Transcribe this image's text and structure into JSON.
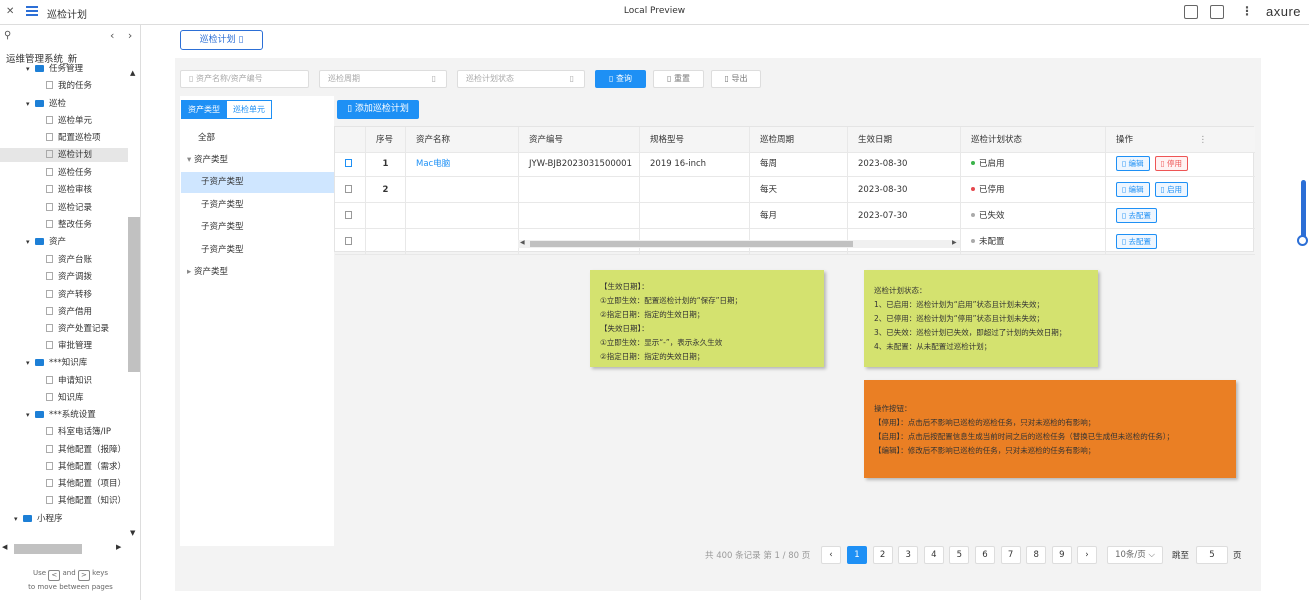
{
  "viewer": {
    "page_name": "巡检计划",
    "title": "Local Preview",
    "logo": "axure",
    "help_text_1": "Use",
    "help_text_2": "and",
    "help_text_3": "keys",
    "help_text_4": "to move between pages",
    "key_left": "<",
    "key_right": ">"
  },
  "sidebar": {
    "project": "运维管理系统_新",
    "items": [
      {
        "label": "任务管理",
        "type": "folder"
      },
      {
        "label": "我的任务",
        "type": "page"
      },
      {
        "label": "巡检",
        "type": "folder"
      },
      {
        "label": "巡检单元",
        "type": "page"
      },
      {
        "label": "配置巡检项",
        "type": "page"
      },
      {
        "label": "巡检计划",
        "type": "page",
        "selected": true
      },
      {
        "label": "巡检任务",
        "type": "page"
      },
      {
        "label": "巡检审核",
        "type": "page"
      },
      {
        "label": "巡检记录",
        "type": "page"
      },
      {
        "label": "整改任务",
        "type": "page"
      },
      {
        "label": "资产",
        "type": "folder"
      },
      {
        "label": "资产台账",
        "type": "page"
      },
      {
        "label": "资产调拨",
        "type": "page"
      },
      {
        "label": "资产转移",
        "type": "page"
      },
      {
        "label": "资产借用",
        "type": "page"
      },
      {
        "label": "资产处置记录",
        "type": "page"
      },
      {
        "label": "审批管理",
        "type": "page"
      },
      {
        "label": "***知识库",
        "type": "folder"
      },
      {
        "label": "申请知识",
        "type": "page"
      },
      {
        "label": "知识库",
        "type": "page"
      },
      {
        "label": "***系统设置",
        "type": "folder"
      },
      {
        "label": "科室电话簿/IP",
        "type": "page"
      },
      {
        "label": "其他配置（报障）",
        "type": "page"
      },
      {
        "label": "其他配置（需求）",
        "type": "page"
      },
      {
        "label": "其他配置（项目）",
        "type": "page"
      },
      {
        "label": "其他配置（知识）",
        "type": "page"
      },
      {
        "label": "小程序",
        "type": "folder"
      }
    ]
  },
  "page": {
    "tab_label": "巡检计划",
    "filters": {
      "asset": "资产名称/资产编号",
      "cycle": "巡检周期",
      "status": "巡检计划状态"
    },
    "buttons": {
      "query": "查询",
      "reset": "重置",
      "export": "导出",
      "add": "添加巡检计划"
    },
    "segment": {
      "asset_type": "资产类型",
      "unit": "巡检单元"
    },
    "categories": [
      {
        "label": "全部",
        "level": 0
      },
      {
        "label": "资产类型",
        "level": 1,
        "expanded": true
      },
      {
        "label": "子资产类型",
        "level": 2,
        "selected": true
      },
      {
        "label": "子资产类型",
        "level": 2
      },
      {
        "label": "子资产类型",
        "level": 2
      },
      {
        "label": "子资产类型",
        "level": 2
      },
      {
        "label": "资产类型",
        "level": 1,
        "expanded": false
      }
    ],
    "table": {
      "columns": [
        "序号",
        "资产名称",
        "资产编号",
        "规格型号",
        "巡检周期",
        "生效日期",
        "巡检计划状态",
        "操作"
      ],
      "rows": [
        {
          "no": "1",
          "name": "Mac电脑",
          "code": "JYW-BJB2023031500001",
          "spec": "2019 16-inch",
          "cycle": "每周",
          "date": "2023-08-30",
          "status": "已启用",
          "status_color": "#3bb34a",
          "ops": [
            "编辑",
            "停用"
          ]
        },
        {
          "no": "2",
          "name": "",
          "code": "",
          "spec": "",
          "cycle": "每天",
          "date": "2023-08-30",
          "status": "已停用",
          "status_color": "#e5484d",
          "ops": [
            "编辑",
            "启用"
          ]
        },
        {
          "no": "",
          "name": "",
          "code": "",
          "spec": "",
          "cycle": "每月",
          "date": "2023-07-30",
          "status": "已失效",
          "status_color": "#aaaaaa",
          "ops": [
            "去配置"
          ]
        },
        {
          "no": "",
          "name": "",
          "code": "",
          "spec": "",
          "cycle": "",
          "date": "",
          "status": "未配置",
          "status_color": "#aaaaaa",
          "ops": [
            "去配置"
          ]
        }
      ]
    },
    "notes": {
      "effective_date": "【生效日期】：\n①立即生效：配置巡检计划的“保存”日期；\n②指定日期：指定的生效日期；\n【失效日期】：\n①立即生效：显示“-”，表示永久生效\n②指定日期：指定的失效日期；",
      "plan_status": "巡检计划状态：\n1、已启用：巡检计划为“启用”状态且计划未失效；\n2、已停用：巡检计划为“停用”状态且计划未失效；\n3、已失效：巡检计划已失效，即超过了计划的失效日期；\n4、未配置：从未配置过巡检计划；",
      "operations": "操作按钮：\n【停用】：点击后不影响已巡检的巡检任务，只对未巡检的有影响；\n【启用】：点击后按配置信息生成当前时间之后的巡检任务（替换已生成但未巡检的任务）；\n【编辑】：修改后不影响已巡检的任务，只对未巡检的任务有影响；"
    },
    "pagination": {
      "summary": "共 400 条记录 第 1 / 80 页",
      "pages": [
        "1",
        "2",
        "3",
        "4",
        "5",
        "6",
        "7",
        "8",
        "9"
      ],
      "current": "1",
      "page_size": "10条/页",
      "jump_label": "跳至",
      "jump_value": "5",
      "jump_unit": "页"
    }
  }
}
